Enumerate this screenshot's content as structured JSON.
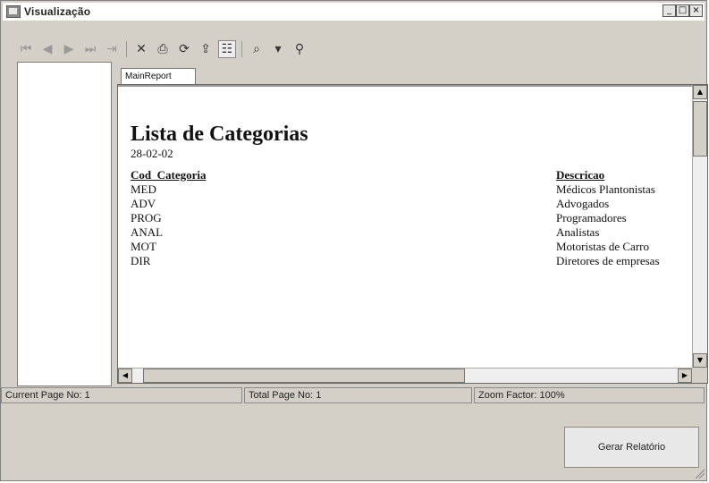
{
  "window": {
    "title": "Visualização",
    "caption_buttons": [
      "_",
      "□",
      "×"
    ]
  },
  "toolbar": {
    "buttons": [
      {
        "icon": "first-page-icon",
        "glyph": "⏮",
        "enabled": false
      },
      {
        "icon": "previous-page-icon",
        "glyph": "◀",
        "enabled": false
      },
      {
        "icon": "next-page-icon",
        "glyph": "▶",
        "enabled": false
      },
      {
        "icon": "last-page-icon",
        "glyph": "⏭",
        "enabled": false
      },
      {
        "icon": "goto-page-icon",
        "glyph": "⇥",
        "enabled": false
      },
      {
        "icon": "close-view-icon",
        "glyph": "✕",
        "enabled": true
      },
      {
        "icon": "print-icon",
        "glyph": "⎙",
        "enabled": true
      },
      {
        "icon": "refresh-icon",
        "glyph": "⟳",
        "enabled": true
      },
      {
        "icon": "export-icon",
        "glyph": "⇪",
        "enabled": true
      },
      {
        "icon": "toggle-tree-icon",
        "glyph": "☷",
        "enabled": true
      },
      {
        "icon": "zoom-icon",
        "glyph": "⌕",
        "enabled": true
      },
      {
        "icon": "zoom-dropdown-icon",
        "glyph": "▾",
        "enabled": true
      },
      {
        "icon": "search-text-icon",
        "glyph": "⚲",
        "enabled": true
      }
    ]
  },
  "tabs": [
    {
      "label": "MainReport"
    }
  ],
  "report": {
    "title": "Lista de Categorias",
    "date": "28-02-02",
    "headers": {
      "code": "Cod_Categoria",
      "description": "Descricao"
    },
    "rows": [
      {
        "code": "MED",
        "description": "Médicos Plantonistas"
      },
      {
        "code": "ADV",
        "description": "Advogados"
      },
      {
        "code": "PROG",
        "description": "Programadores"
      },
      {
        "code": "ANAL",
        "description": "Analistas"
      },
      {
        "code": "MOT",
        "description": "Motoristas de Carro"
      },
      {
        "code": "DIR",
        "description": "Diretores de empresas"
      }
    ]
  },
  "status": {
    "current_page": "Current Page No: 1",
    "total_pages": "Total Page No: 1",
    "zoom": "Zoom Factor: 100%"
  },
  "actions": {
    "generate_report": "Gerar Relatório"
  }
}
